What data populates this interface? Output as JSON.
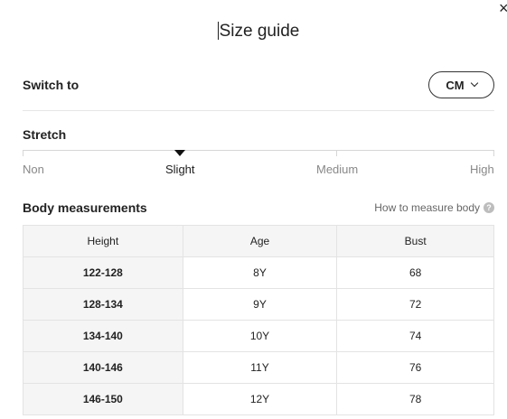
{
  "close": {
    "icon": "close-icon",
    "glyph": "×"
  },
  "header": {
    "title": "Size guide"
  },
  "switch": {
    "label": "Switch to",
    "unit": "CM"
  },
  "stretch": {
    "title": "Stretch",
    "options": [
      "Non",
      "Slight",
      "Medium",
      "High"
    ],
    "selected": "Slight"
  },
  "body": {
    "title": "Body measurements",
    "how_to_measure": "How to measure body",
    "help_glyph": "?"
  },
  "table": {
    "columns": [
      "Height",
      "Age",
      "Bust"
    ],
    "rows": [
      [
        "122-128",
        "8Y",
        "68"
      ],
      [
        "128-134",
        "9Y",
        "72"
      ],
      [
        "134-140",
        "10Y",
        "74"
      ],
      [
        "140-146",
        "11Y",
        "76"
      ],
      [
        "146-150",
        "12Y",
        "78"
      ]
    ]
  }
}
